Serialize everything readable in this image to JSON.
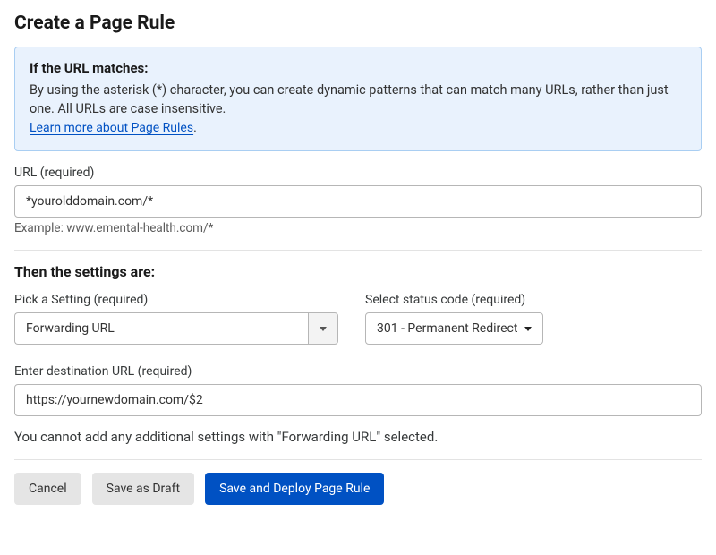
{
  "title": "Create a Page Rule",
  "info": {
    "heading": "If the URL matches:",
    "text": "By using the asterisk (*) character, you can create dynamic patterns that can match many URLs, rather than just one. All URLs are case insensitive.",
    "link_text": "Learn more about Page Rules",
    "link_suffix": "."
  },
  "url": {
    "label": "URL (required)",
    "value": "*yourolddomain.com/*",
    "hint": "Example: www.emental-health.com/*"
  },
  "settings_heading": "Then the settings are:",
  "setting": {
    "label": "Pick a Setting (required)",
    "value": "Forwarding URL"
  },
  "status": {
    "label": "Select status code (required)",
    "value": "301 - Permanent Redirect"
  },
  "destination": {
    "label": "Enter destination URL (required)",
    "value": "https://yournewdomain.com/$2"
  },
  "note": "You cannot add any additional settings with \"Forwarding URL\" selected.",
  "buttons": {
    "cancel": "Cancel",
    "draft": "Save as Draft",
    "save": "Save and Deploy Page Rule"
  }
}
